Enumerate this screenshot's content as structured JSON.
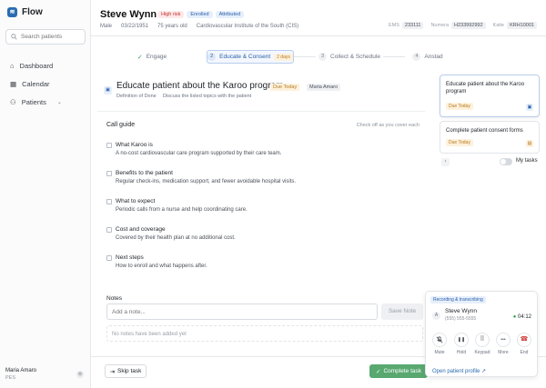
{
  "app": {
    "name": "Flow",
    "logo_glyph": "≋"
  },
  "search": {
    "placeholder": "Search patients"
  },
  "nav": [
    {
      "label": "Dashboard",
      "icon": "home-icon",
      "glyph": "⌂"
    },
    {
      "label": "Calendar",
      "icon": "calendar-icon",
      "glyph": "▦"
    },
    {
      "label": "Patients",
      "icon": "users-icon",
      "glyph": "⚇",
      "chevron": "⌄"
    }
  ],
  "user": {
    "name": "Maria Amaro",
    "role": "PES",
    "menu_glyph": "⚙"
  },
  "patient": {
    "name": "Steve Wynn",
    "badges": [
      "High risk",
      "Enrolled",
      "Attributed"
    ],
    "sex": "Male",
    "dob": "03/22/1951",
    "age": "75 years old",
    "program": "Cardiovascular Institute of the South (CIS)",
    "ids": [
      {
        "label": "EMS",
        "value": "233111"
      },
      {
        "label": "Numera",
        "value": "H233992992"
      },
      {
        "label": "Katie",
        "value": "KRH10001"
      }
    ]
  },
  "steps": [
    {
      "num": "✓",
      "label": "Engage",
      "state": "done"
    },
    {
      "num": "2",
      "label": "Educate & Consent",
      "state": "active",
      "due": "2 days"
    },
    {
      "num": "3",
      "label": "Collect & Schedule",
      "state": "todo"
    },
    {
      "num": "4",
      "label": "Anstad",
      "state": "todo"
    }
  ],
  "task": {
    "title": "Educate patient about the Karoo program",
    "due": "Due Today",
    "assignee": "Maria Amaro",
    "dod_label": "Definition of Done",
    "dod_text": "Discuss the listed topics with the patient"
  },
  "guide": {
    "title": "Call guide",
    "hint": "Check off as you cover each",
    "items": [
      {
        "title": "What Karoo is",
        "desc": "A no-cost cardiovascular care program supported by their care team."
      },
      {
        "title": "Benefits to the patient",
        "desc": "Regular check-ins, medication support, and fewer avoidable hospital visits."
      },
      {
        "title": "What to expect",
        "desc": "Periodic calls from a nurse and help coordinating care."
      },
      {
        "title": "Cost and coverage",
        "desc": "Covered by their health plan at no additional cost."
      },
      {
        "title": "Next steps",
        "desc": "How to enroll and what happens after."
      }
    ]
  },
  "notes": {
    "label": "Notes",
    "placeholder": "Add a note...",
    "save_label": "Save Note",
    "empty_text": "No notes have been added yet"
  },
  "footer": {
    "skip_label": "Skip task",
    "complete_label": "Complete task"
  },
  "queue": {
    "cards": [
      {
        "title": "Educate patient about the Karoo program",
        "due": "Due Today",
        "icon_color": "#2b5fa8",
        "icon_bg": "#e6effb"
      },
      {
        "title": "Complete patient consent forms",
        "due": "Due Today",
        "icon_color": "#b7791f",
        "icon_bg": "#fdf1dc"
      }
    ],
    "toggle_label": "My tasks"
  },
  "call": {
    "status": "Recording & transcribing",
    "avatar": "A",
    "name": "Steve Wynn",
    "phone": "(555) 555-5555",
    "timer": "04:12",
    "controls": [
      {
        "label": "Mute",
        "glyph": "🎙",
        "icon": "mute-icon"
      },
      {
        "label": "Hold",
        "glyph": "❚❚",
        "icon": "pause-icon"
      },
      {
        "label": "Keypad",
        "glyph": "⠿",
        "icon": "keypad-icon"
      },
      {
        "label": "More",
        "glyph": "•••",
        "icon": "more-icon"
      },
      {
        "label": "End",
        "glyph": "☎",
        "icon": "end-call-icon"
      }
    ],
    "open_profile": "Open patient profile"
  }
}
